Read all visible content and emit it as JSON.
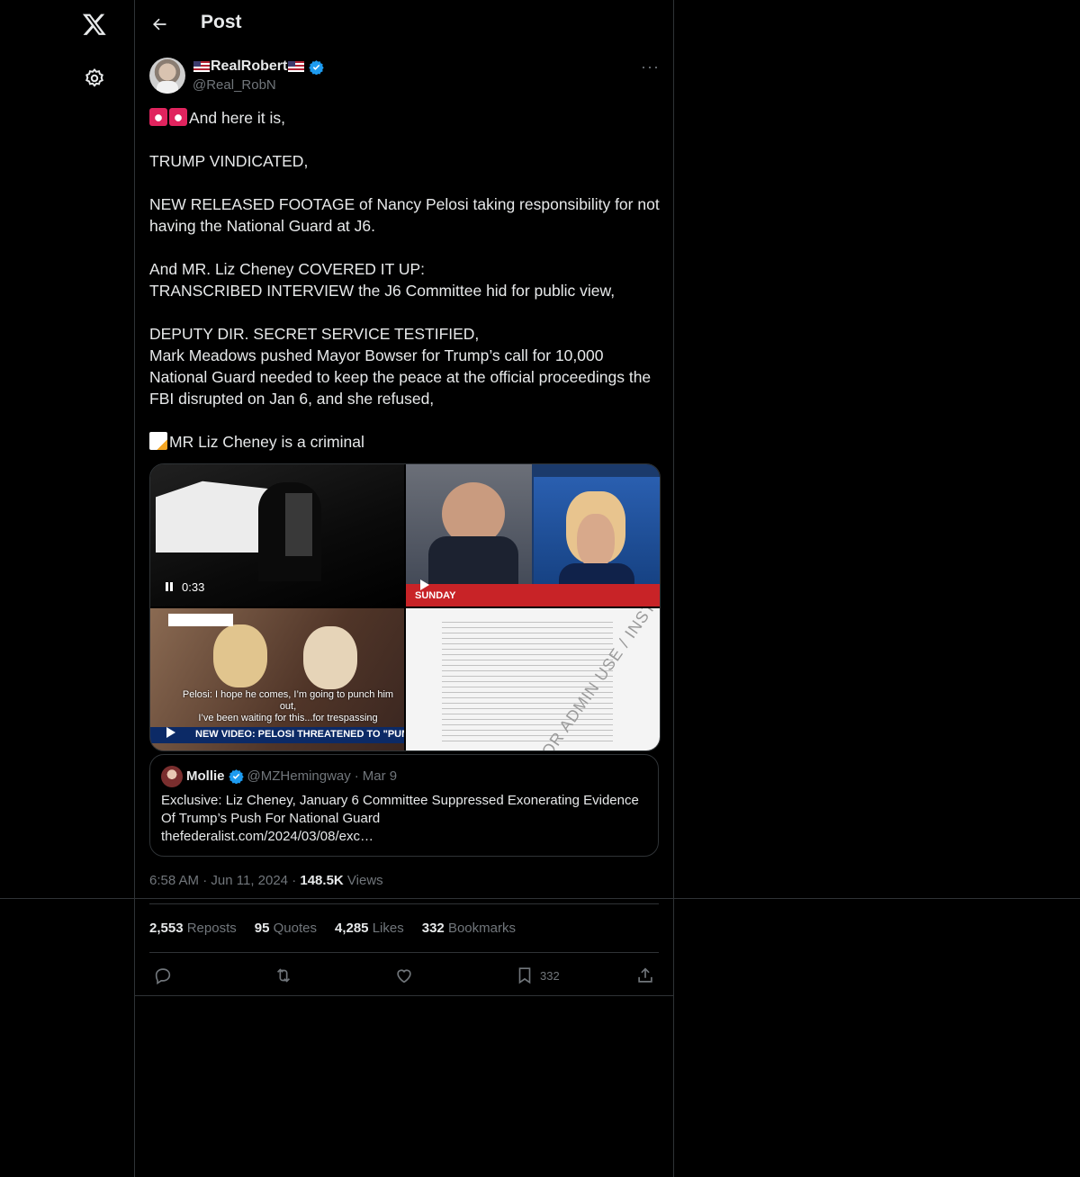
{
  "header": {
    "title": "Post"
  },
  "post": {
    "display_name": "RealRobert",
    "handle": "@Real_RobN",
    "text": "And here it is,\n\nTRUMP VINDICATED,\n\nNEW RELEASED FOOTAGE of Nancy Pelosi taking responsibility for not having the National Guard at J6.\n\nAnd MR. Liz Cheney COVERED IT UP:\nTRANSCRIBED INTERVIEW the J6 Committee hid for public view,\n\nDEPUTY DIR. SECRET SERVICE TESTIFIED,\nMark Meadows pushed Mayor Bowser for Trump’s call for 10,000 National Guard needed to keep the peace at the official proceedings the FBI disrupted on Jan 6, and she refused,\n\n",
    "last_line": "MR Liz Cheney is a criminal",
    "media": {
      "video1_time": "0:33",
      "tile3_caption": "Pelosi: I hope he comes, I’m going to punch him out,\nI’ve been waiting for this...for trespassing",
      "tile2_label": "SUNDAY",
      "tile3_banner": "NEW VIDEO: PELOSI THREATENED TO \"PUNCH OUT\" TRUM",
      "tile4_watermark": "FOR ADMIN USE / INSTITUTE"
    },
    "quote": {
      "name": "Mollie",
      "handle": "@MZHemingway",
      "date": "Mar 9",
      "text": "Exclusive: Liz Cheney, January 6 Committee Suppressed Exonerating Evidence Of Trump’s Push For National Guard",
      "link": "thefederalist.com/2024/03/08/exc…"
    },
    "time": "6:58 AM",
    "date": "Jun 11, 2024",
    "views_count": "148.5K",
    "views_label": "Views",
    "stats": {
      "reposts": "2,553",
      "reposts_label": "Reposts",
      "quotes": "95",
      "quotes_label": "Quotes",
      "likes": "4,285",
      "likes_label": "Likes",
      "bookmarks": "332",
      "bookmarks_label": "Bookmarks"
    },
    "actions": {
      "bookmark_count": "332"
    }
  },
  "icons": [
    "x-logo-icon",
    "gear-icon",
    "back-arrow-icon",
    "verified-icon",
    "more-icon",
    "pause-icon",
    "play-icon",
    "reply-icon",
    "repost-icon",
    "like-icon",
    "bookmark-icon",
    "share-icon"
  ],
  "colors": {
    "background": "#000000",
    "text": "#e7e9ea",
    "muted": "#71767b",
    "border": "#2f3336",
    "verified": "#1d9bf0"
  }
}
